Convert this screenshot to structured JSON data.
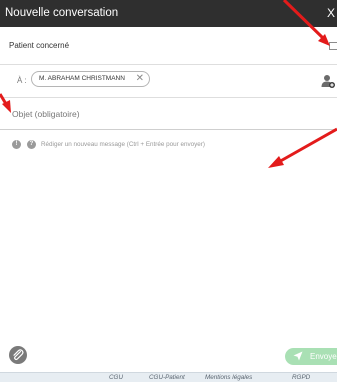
{
  "window": {
    "title": "Nouvelle conversation",
    "close_glyph": "X"
  },
  "patient_row": {
    "label": "Patient concerné"
  },
  "recipient_row": {
    "to_label": "À :",
    "chip_name": "M. ABRAHAM CHRISTMANN",
    "chip_remove_glyph": "✕",
    "add_user_icon": "user-add-icon"
  },
  "subject": {
    "placeholder": "Objet (obligatoire)"
  },
  "compose": {
    "icon_1": "!",
    "icon_2": "?",
    "placeholder": "Rédiger un nouveau message (Ctrl + Entrée pour envoyer)"
  },
  "toolbar": {
    "attach_icon": "paperclip-icon",
    "send_label": "Envoyer",
    "send_icon": "paper-plane-icon"
  },
  "footer": {
    "links": [
      "CGU",
      "CGU-Patient",
      "Mentions légales",
      "RGPD"
    ]
  },
  "colors": {
    "titlebar": "#2f2f2f",
    "send_button": "#a9e0b4",
    "annotation_arrow": "#e31b1b",
    "footer_bg": "#e7edf2"
  }
}
